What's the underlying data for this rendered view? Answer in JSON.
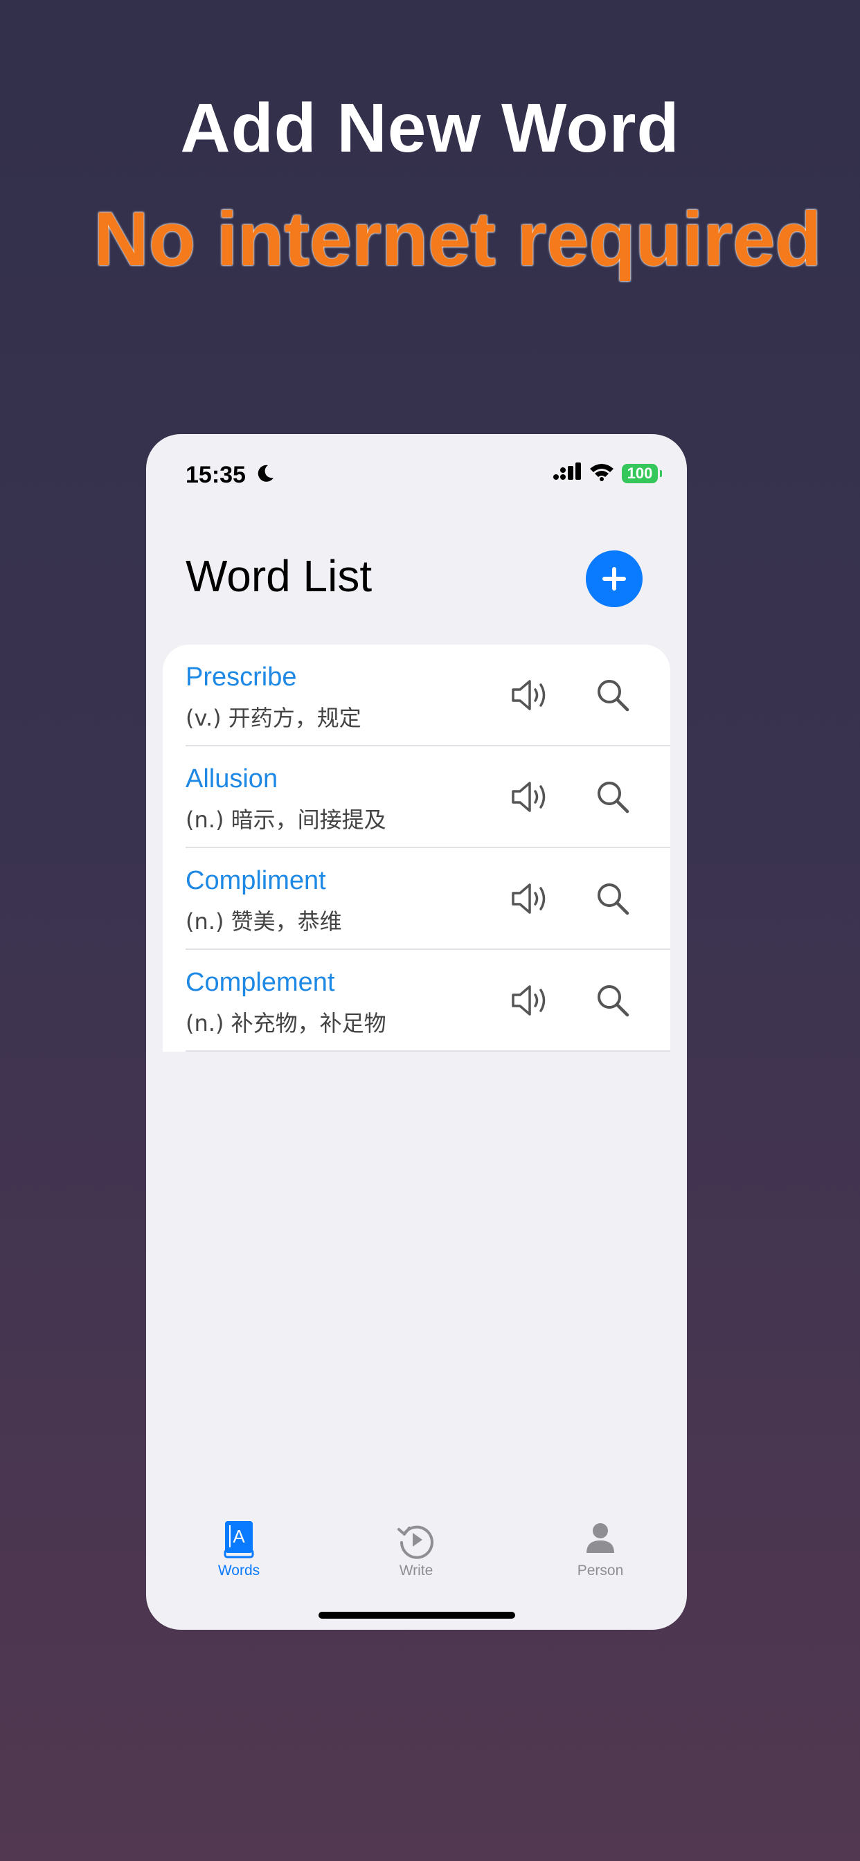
{
  "promo": {
    "headline": "Add New Word",
    "subheadline": "No internet required",
    "subheadline_color": "#f47a1b"
  },
  "status_bar": {
    "time": "15:35",
    "battery": "100",
    "icons": [
      "moon-icon",
      "cellular-signal-icon",
      "wifi-icon",
      "battery-icon"
    ]
  },
  "header": {
    "title": "Word List",
    "add_icon": "plus-icon"
  },
  "words": [
    {
      "word": "Prescribe",
      "meaning": "(v.) 开药方，规定"
    },
    {
      "word": "Allusion",
      "meaning": "(n.) 暗示，间接提及"
    },
    {
      "word": "Compliment",
      "meaning": "(n.) 赞美，恭维"
    },
    {
      "word": "Complement",
      "meaning": "(n.) 补充物，补足物"
    }
  ],
  "tab_bar": {
    "tabs": [
      {
        "label": "Words",
        "icon": "book-icon",
        "active": true
      },
      {
        "label": "Write",
        "icon": "replay-icon",
        "active": false
      },
      {
        "label": "Person",
        "icon": "person-icon",
        "active": false
      }
    ]
  },
  "colors": {
    "accent": "#0a7aff",
    "word_link": "#1e88e5",
    "battery": "#35c759",
    "background": "#f0f0f5"
  }
}
